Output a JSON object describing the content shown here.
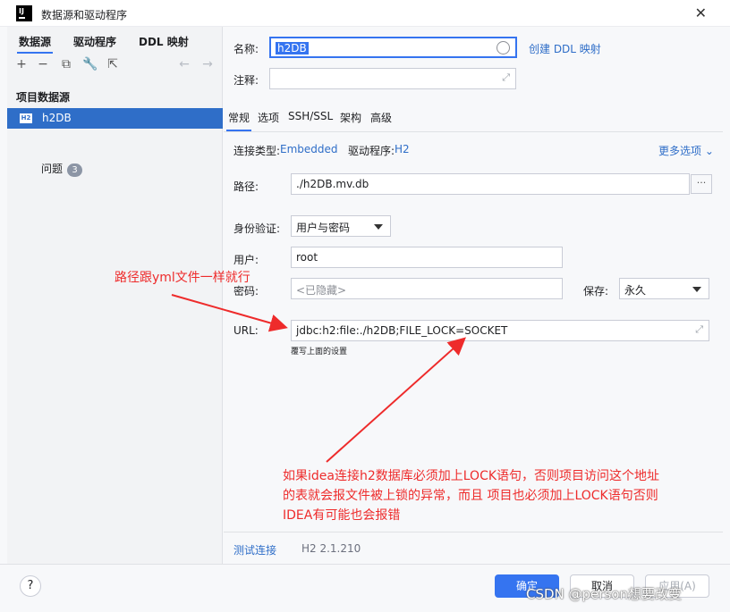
{
  "window": {
    "title": "数据源和驱动程序",
    "logo_text": "IJ",
    "close_glyph": "✕"
  },
  "left": {
    "tabs": [
      "数据源",
      "驱动程序",
      "DDL 映射"
    ],
    "toolbar": {
      "add": "+",
      "remove": "−",
      "copy": "⧉",
      "wrench": "🔧",
      "open": "⇱",
      "back": "←",
      "forward": "→"
    },
    "section_title": "项目数据源",
    "datasource": {
      "icon_text": "H2",
      "name": "h2DB"
    },
    "problems": {
      "label": "问题",
      "count": "3"
    }
  },
  "right": {
    "name_label": "名称:",
    "name_value": "h2DB",
    "create_ddl_link": "创建 DDL 映射",
    "comment_label": "注释:",
    "comment_value": "",
    "tabs": [
      "常规",
      "选项",
      "SSH/SSL",
      "架构",
      "高级"
    ],
    "conn_type_label": "连接类型:",
    "conn_type_value": "Embedded",
    "driver_label": "驱动程序:",
    "driver_value": "H2",
    "more_options": "更多选项",
    "path_label": "路径:",
    "path_value": "./h2DB.mv.db",
    "path_browse": "···",
    "auth_label": "身份验证:",
    "auth_value": "用户与密码",
    "user_label": "用户:",
    "user_value": "root",
    "password_label": "密码:",
    "password_value": "<已隐藏>",
    "save_label": "保存:",
    "save_value": "永久",
    "url_label": "URL:",
    "url_value": "jdbc:h2:file:./h2DB;FILE_LOCK=SOCKET",
    "url_hint": "覆写上面的设置",
    "test_connection": "测试连接",
    "driver_version": "H2 2.1.210"
  },
  "bottom": {
    "help": "?",
    "ok": "确定",
    "cancel": "取消",
    "apply": "应用(A)",
    "watermark": "CSDN @person想要改变"
  },
  "annotations": {
    "path_note": "路径跟yml文件一样就行",
    "lock_note_1": "如果idea连接h2数据库必须加上LOCK语句，否则项目访问这个地址",
    "lock_note_2": "的表就会报文件被上锁的异常，而且 项目也必须加上LOCK语句否则",
    "lock_note_3": "IDEA有可能也会报错",
    "color": "#ee2b2b"
  },
  "colors": {
    "accent": "#3574f0",
    "selection": "#2f6ec8",
    "link": "#2f6ec8"
  }
}
